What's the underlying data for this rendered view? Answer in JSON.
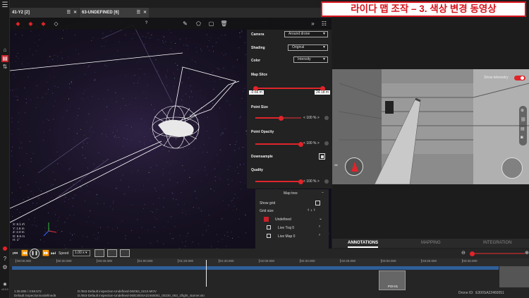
{
  "overlay_title": "라이다 맵 조작 – 3. 색상 변경 동영상",
  "tabs": [
    {
      "label": "41-Y2 [2]"
    },
    {
      "label": "63-UNDEFINED [6]"
    }
  ],
  "viewport": {
    "help": "?",
    "coords": {
      "x": "X: 8.1 m",
      "y": "Y: 1.5 m",
      "z": "Z: 2.0 m",
      "d": "D: 8.6 m",
      "h": "H: 1°"
    }
  },
  "settings": {
    "camera_label": "Camera",
    "camera_value": "Around drone",
    "shading_label": "Shading",
    "shading_value": "Original",
    "color_label": "Color",
    "color_value": "Intensity",
    "map_slice_label": "Map Slice",
    "map_slice_min": "-0.66 m",
    "map_slice_max": "24.18 m",
    "point_size_label": "Point Size",
    "point_size_value": "100 %",
    "point_opacity_label": "Point Opacity",
    "point_opacity_value": "100 %",
    "downsample_label": "Downsample",
    "quality_label": "Quality",
    "quality_value": "100 %"
  },
  "maptree": {
    "title": "Map tree",
    "show_grid": "Show grid",
    "grid_size": "Grid size",
    "grid_value": "1",
    "undefined": "Undefined",
    "live_traj": "Live Traj 0",
    "live_map": "Live Map 0"
  },
  "video": {
    "show_telemetry": "Show telemetry",
    "alt_label": "Alt"
  },
  "annotations_tabs": [
    "ANNOTATIONS",
    "MAPPING",
    "INTEGRATION"
  ],
  "playback": {
    "speed_label": "Speed",
    "speed_value": "1.00 x",
    "ticks": [
      "00:00.000",
      "00:20.000",
      "00:40.000",
      "01:00.000",
      "01:20.000",
      "01:40.000",
      "02:00.000",
      "02:20.000",
      "02:40.000",
      "03:00.000",
      "03:20.000",
      "03:40.000"
    ],
    "poi_label": "POI-01",
    "time_line1": "1:35.895 / 3:59.572",
    "time_line2": "Default inspection/undefined6",
    "path_line1": "D:/063-Default inspection-Undefined-06/063_0210.MOV",
    "path_line2": "D:/063-Default inspection-Undefined-06/E300SA22460051_00230_063_1flight_starnet.stn",
    "drone_id_label": "Drone ID:",
    "drone_id_value": "E300SA22460051",
    "version": "v3.0.0"
  },
  "colors": {
    "accent": "#e0242a",
    "panel": "#222222",
    "timeline_bar": "#2f5f9a"
  }
}
